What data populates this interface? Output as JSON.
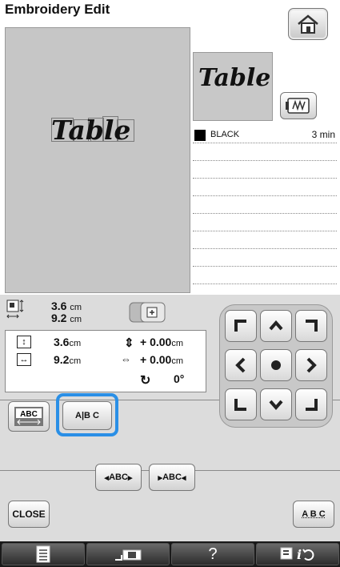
{
  "header": {
    "title": "Embroidery Edit"
  },
  "canvas": {
    "text": "Table"
  },
  "preview": {
    "text": "Table"
  },
  "threads": [
    {
      "color": "#000000",
      "name": "BLACK",
      "time": "3 min"
    }
  ],
  "size_summary": {
    "width": "3.6",
    "height": "9.2",
    "unit": "cm"
  },
  "info": {
    "height_value": "3.6",
    "width_value": "9.2",
    "unit": "cm",
    "vertical_offset": "+ 0.00",
    "horizontal_offset": "+ 0.00",
    "rotation": "0°"
  },
  "buttons": {
    "close": "CLOSE",
    "abc_straight": "A B C",
    "abc_spaced": "A|B C",
    "abc_narrow": "ABC",
    "abc_wide": "ABC",
    "abc_bottom": "A B C",
    "help": "?"
  },
  "colors": {
    "selection": "#2a8fe6",
    "panel": "#dcdcdc",
    "canvas": "#c6c6c6"
  }
}
